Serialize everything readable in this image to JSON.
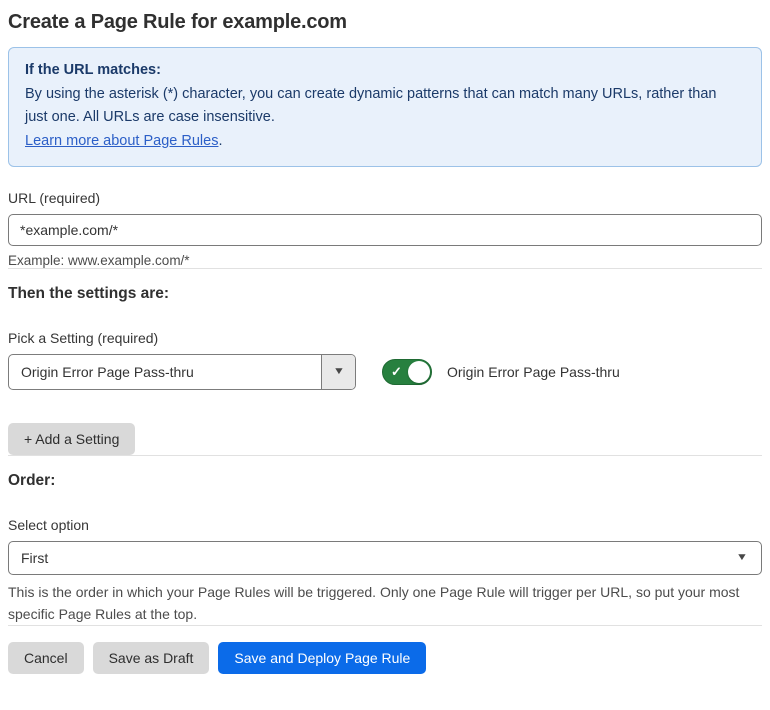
{
  "page": {
    "title": "Create a Page Rule for example.com"
  },
  "info_box": {
    "heading": "If the URL matches:",
    "body": "By using the asterisk (*) character, you can create dynamic patterns that can match many URLs, rather than just one. All URLs are case insensitive.",
    "link_label": "Learn more about Page Rules",
    "link_suffix": "."
  },
  "url_field": {
    "label": "URL (required)",
    "value": "*example.com/*",
    "helper": "Example: www.example.com/*"
  },
  "settings_section": {
    "heading": "Then the settings are:",
    "picker_label": "Pick a Setting (required)",
    "picker_value": "Origin Error Page Pass-thru",
    "toggle_label": "Origin Error Page Pass-thru",
    "toggle_state": "on",
    "add_setting_label": "+ Add a Setting"
  },
  "order_section": {
    "heading": "Order:",
    "select_label": "Select option",
    "select_value": "First",
    "helper": "This is the order in which your Page Rules will be triggered. Only one Page Rule will trigger per URL, so put your most specific Page Rules at the top."
  },
  "footer": {
    "cancel_label": "Cancel",
    "save_draft_label": "Save as Draft",
    "save_deploy_label": "Save and Deploy Page Rule"
  },
  "colors": {
    "accent_blue": "#0b6be9",
    "toggle_green": "#27803f",
    "info_background": "#e9f1fb",
    "info_border": "#9cc2e8",
    "info_text": "#1b3a69",
    "link_blue": "#2c5fc7"
  },
  "icons": {
    "dropdown_arrow": "▼",
    "toggle_check": "✓"
  }
}
